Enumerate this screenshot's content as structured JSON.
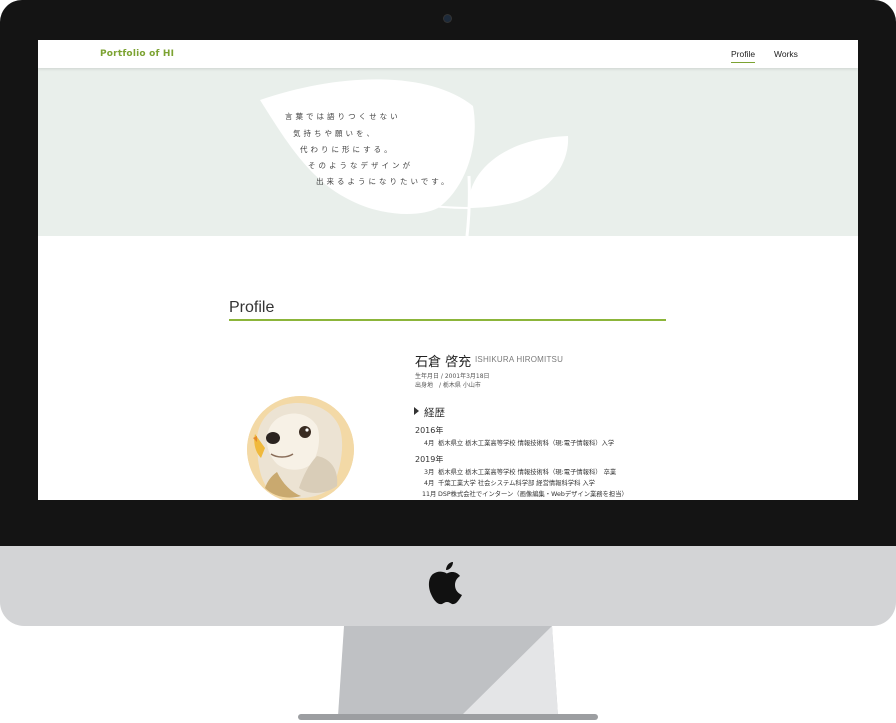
{
  "colors": {
    "accent": "#7ca332",
    "hero_bg": "#e9efeb",
    "bezel": "#141414",
    "chin": "#d3d4d6"
  },
  "site": {
    "logo": "Portfolio of HI",
    "nav": [
      {
        "label": "Profile",
        "active": true
      },
      {
        "label": "Works",
        "active": false
      }
    ]
  },
  "hero": {
    "lines": [
      "言葉では語りつくせない",
      "気持ちや願いを、",
      "代わりに形にする。",
      "そのようなデザインが",
      "出来るようになりたいです。"
    ]
  },
  "profile": {
    "section_title": "Profile",
    "name_jp": "石倉 啓充",
    "name_en": "ISHIKURA HIROMITSU",
    "birth": "生年月日 / 2001年3月18日",
    "origin": "出身地　/ 栃木県 小山市",
    "career_heading": "経歴",
    "career": [
      {
        "year": "2016年",
        "entries": [
          {
            "month": "4月",
            "text": "栃木県立 栃木工業高等学校 情報技術科（現:電子情報科）入学"
          }
        ]
      },
      {
        "year": "2019年",
        "entries": [
          {
            "month": "3月",
            "text": "栃木県立 栃木工業高等学校 情報技術科（現:電子情報科） 卒業"
          },
          {
            "month": "4月",
            "text": "千葉工業大学 社会システム科学部 経営情報科学科 入学"
          },
          {
            "month": "11月",
            "text": "DSP株式会社でインターン（画像編集・Webデザイン業務を担当）"
          }
        ]
      }
    ]
  },
  "icons": {
    "camera": "camera-icon",
    "apple": "apple-logo-icon",
    "avatar": "dog-illustration"
  }
}
